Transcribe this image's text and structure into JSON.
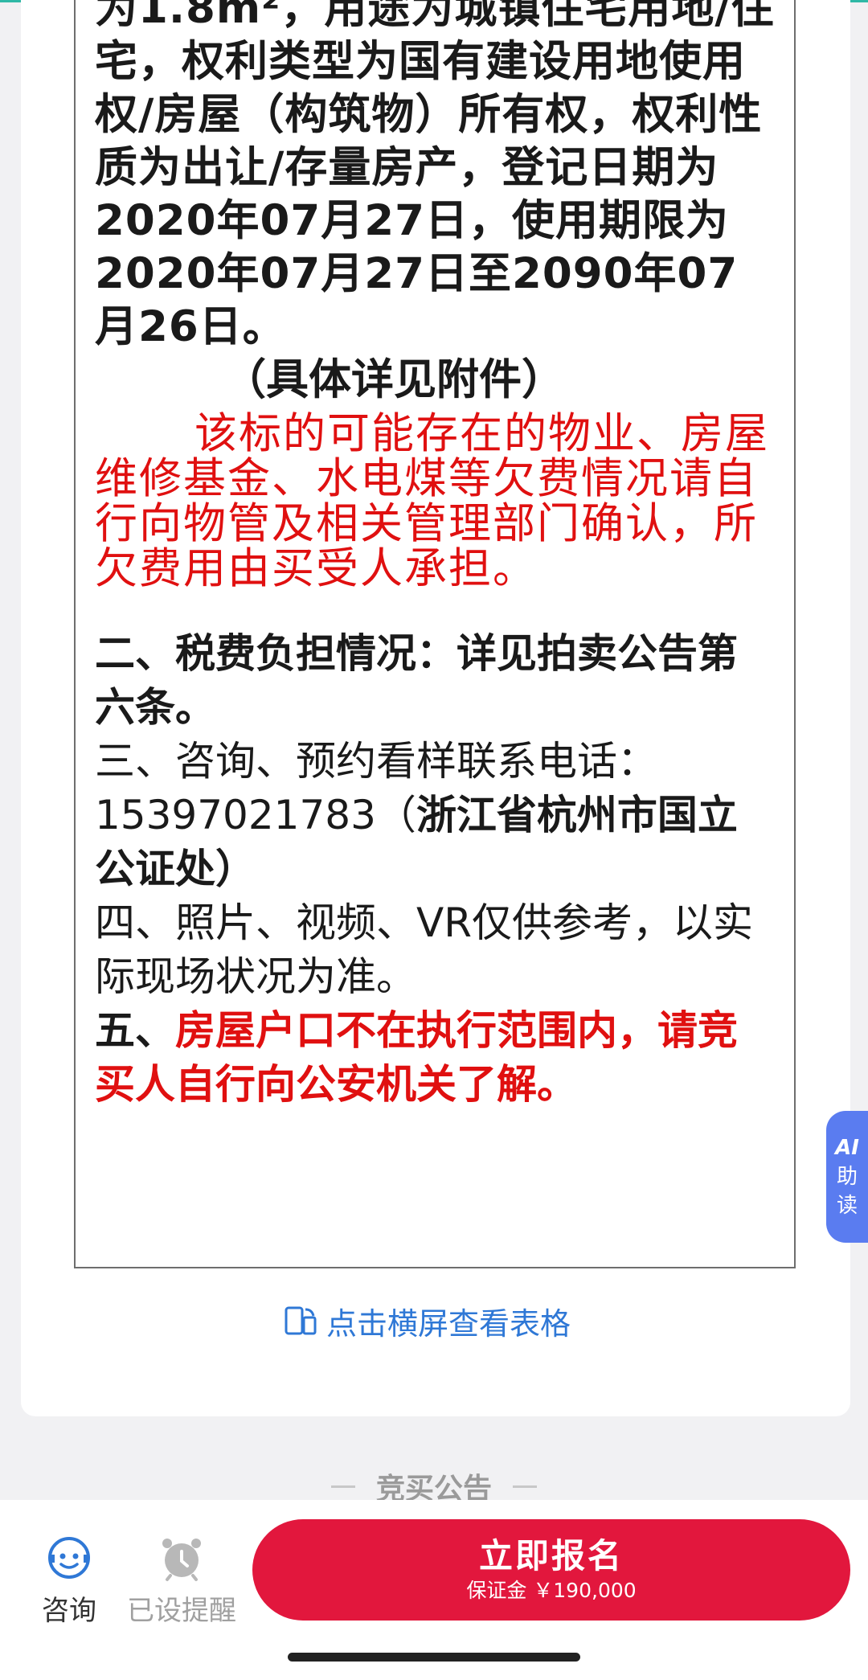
{
  "content": {
    "p1": "为1.8m²，用途为城镇住宅用地/住宅，权利类型为国有建设用地使用权/房屋（构筑物）所有权，权利性质为出让/存量房产，登记日期为2020年07月27日，使用期限为2020年07月27日至2090年07月26日。",
    "p2": "（具体详见附件）",
    "p3": "该标的可能存在的物业、房屋维修基金、水电煤等欠费情况请自行向物管及相关管理部门确认，所欠费用由买受人承担。",
    "s2": "二、税费负担情况：详见拍卖公告第六条。",
    "s3_a": "三、咨询、预约看样联系电话：15397021783（",
    "s3_b": "浙江省杭州市国立公证处",
    "s3_c": "）",
    "s4": "四、照片、视频、VR仅供参考，以实际现场状况为准。",
    "s5_a": "五、",
    "s5_b": "房屋户口不在执行范围内，请竞买人自行向公安机关了解。"
  },
  "landscape_hint": "点击横屏查看表格",
  "ai_tab": {
    "ai": "AI",
    "line1": "助",
    "line2": "读"
  },
  "section_title": "竞买公告",
  "bottom": {
    "consult_label": "咨询",
    "remind_label": "已设提醒",
    "signup_label": "立即报名",
    "deposit": "保证金 ￥190,000"
  },
  "colors": {
    "signup": "#e2173d",
    "link": "#2f78d6",
    "ai_tab": "#5a7cf0",
    "warning_text": "#e01010"
  },
  "icons": [
    "landscape-rotate-icon",
    "consult-icon",
    "alarm-clock-icon"
  ]
}
